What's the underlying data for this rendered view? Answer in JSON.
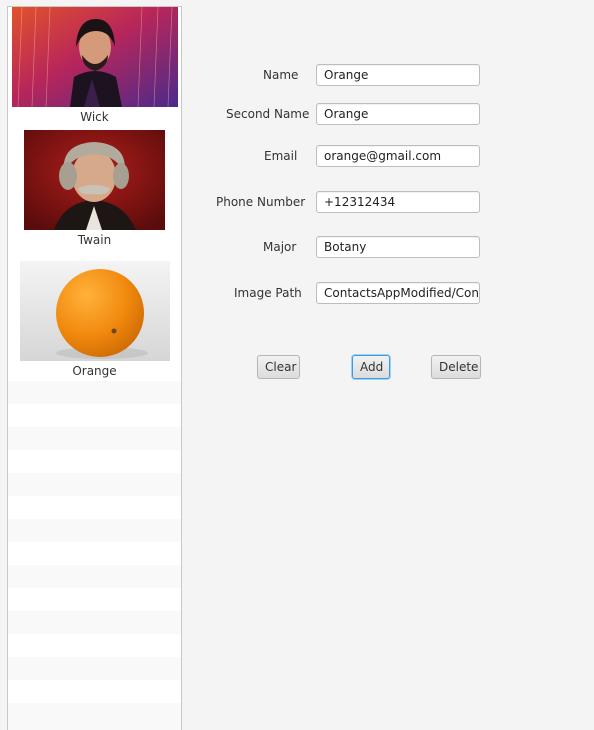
{
  "contacts": [
    {
      "name": "Wick",
      "image": "portrait-photo"
    },
    {
      "name": "Twain",
      "image": "portrait-painting"
    },
    {
      "name": "Orange",
      "image": "orange-fruit-photo"
    }
  ],
  "form": {
    "name_label": "Name",
    "name_value": "Orange",
    "second_name_label": "Second Name",
    "second_name_value": "Orange",
    "email_label": "Email",
    "email_value": "orange@gmail.com",
    "phone_label": "Phone Number",
    "phone_value": "+12312434",
    "major_label": "Major",
    "major_value": "Botany",
    "image_path_label": "Image Path",
    "image_path_value": "ContactsAppModified/Conta"
  },
  "buttons": {
    "clear": "Clear",
    "add": "Add",
    "delete": "Delete"
  },
  "colors": {
    "background": "#f4f4f4",
    "focus_ring": "#3c9be0",
    "orange": "#f28a0f"
  }
}
